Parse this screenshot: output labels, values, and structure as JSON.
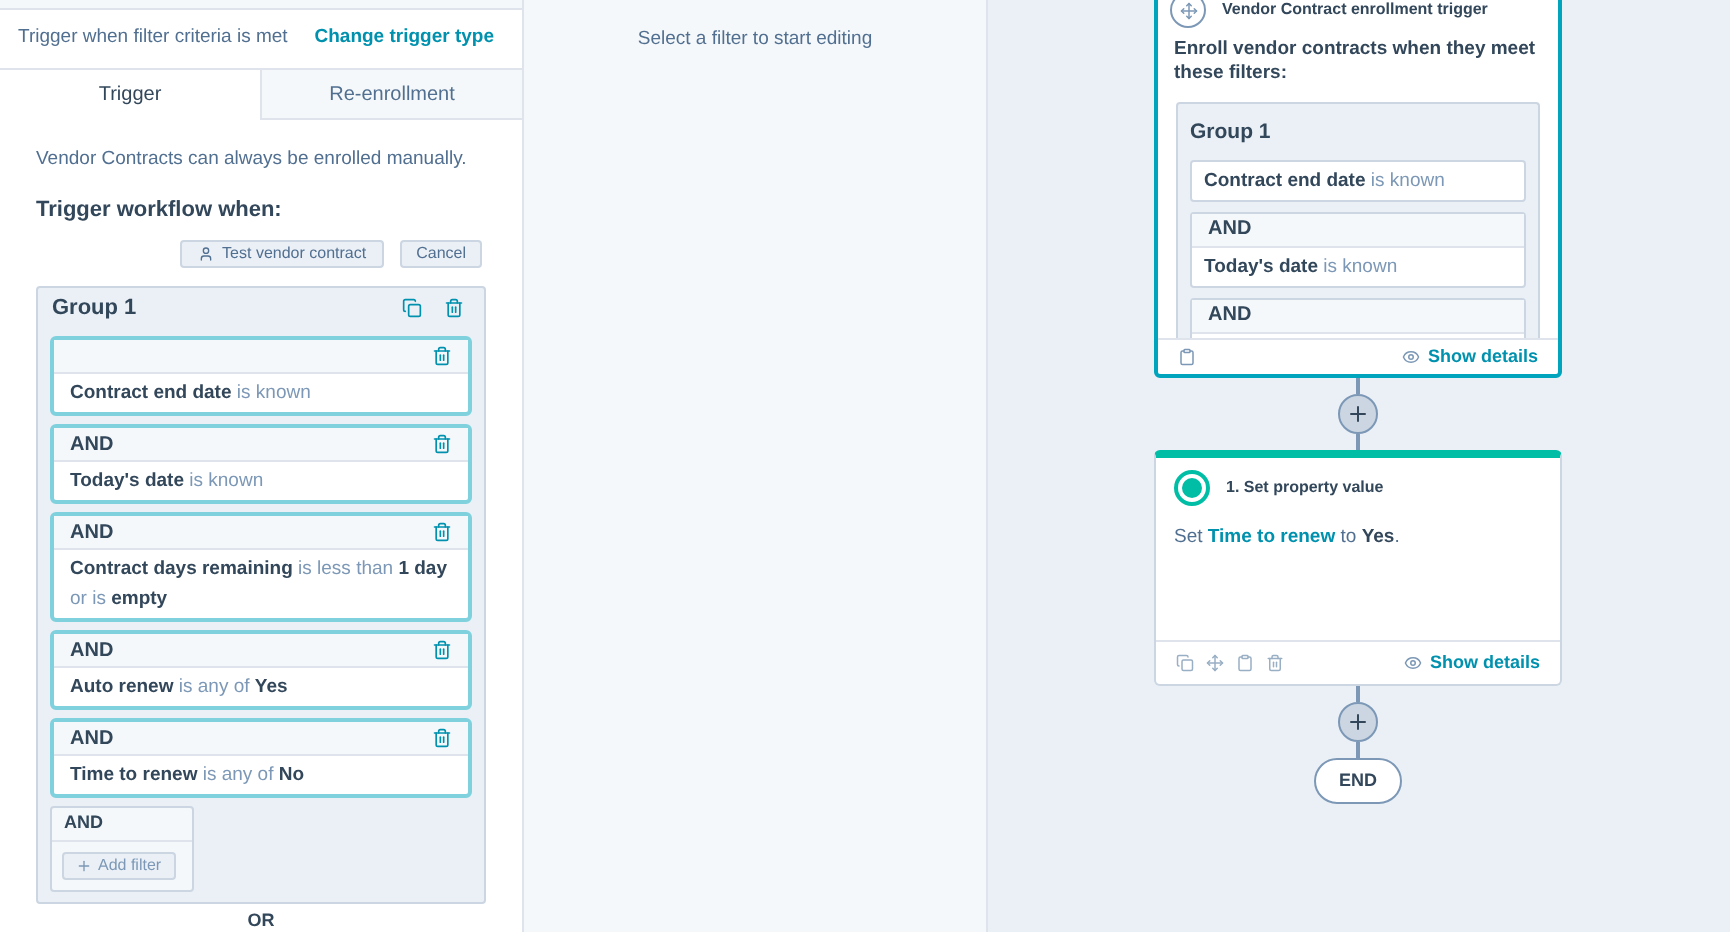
{
  "left_panel": {
    "header_text": "Trigger when filter criteria is met",
    "change_link": "Change trigger type",
    "tabs": [
      {
        "label": "Trigger",
        "selected": true
      },
      {
        "label": "Re-enrollment",
        "selected": false
      }
    ],
    "note": "Vendor Contracts can always be enrolled manually.",
    "heading": "Trigger workflow when:",
    "test_button": "Test vendor contract",
    "cancel_button": "Cancel",
    "group": {
      "title": "Group 1",
      "filters": [
        {
          "text": "**Contract end date** is known"
        },
        {
          "connector": "AND",
          "text": "**Today's date** is known"
        },
        {
          "connector": "AND",
          "text": "**Contract days remaining** is less than **1 day** or is **empty**"
        },
        {
          "connector": "AND",
          "text": "**Auto renew** is any of **Yes**"
        },
        {
          "connector": "AND",
          "text": "**Time to renew** is any of **No**"
        }
      ],
      "add_connector": "AND",
      "add_filter": "Add filter"
    },
    "or_label": "OR"
  },
  "middle_panel": {
    "hint": "Select a filter to start editing"
  },
  "canvas": {
    "trigger_card": {
      "title": "Vendor Contract enrollment trigger",
      "description": "Enroll vendor contracts when they meet these filters:",
      "group_title": "Group 1",
      "filters": [
        {
          "text": "**Contract end date** is known"
        },
        {
          "connector": "AND",
          "text": "**Today's date** is known"
        },
        {
          "connector": "AND"
        }
      ],
      "show_details": "Show details"
    },
    "action_card": {
      "title": "1. Set property value",
      "sentence": [
        {
          "kind": "plain",
          "text": "Set "
        },
        {
          "kind": "property",
          "text": "Time to renew"
        },
        {
          "kind": "plain",
          "text": " to "
        },
        {
          "kind": "value",
          "text": "Yes"
        },
        {
          "kind": "plain",
          "text": "."
        }
      ],
      "show_details": "Show details"
    },
    "end_label": "END"
  }
}
